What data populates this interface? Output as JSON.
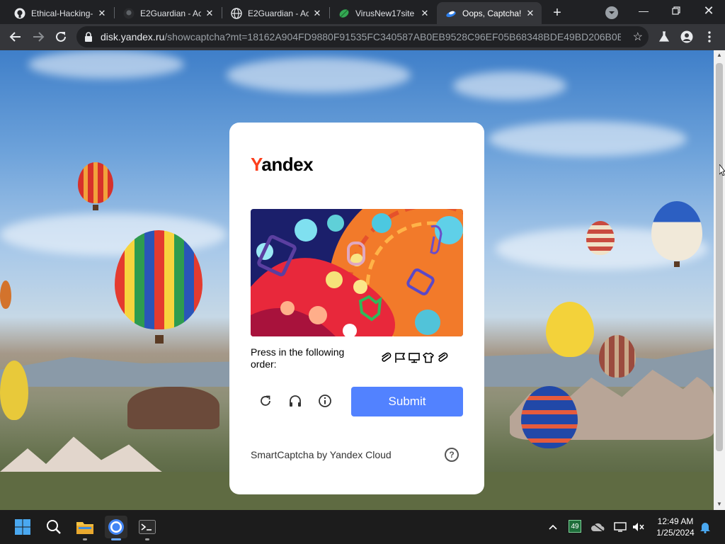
{
  "browser": {
    "tabs": [
      {
        "title": "Ethical-Hacking-",
        "favicon": "github-icon"
      },
      {
        "title": "E2Guardian - Ac",
        "favicon": "github-icon"
      },
      {
        "title": "E2Guardian - Ac",
        "favicon": "globe-icon"
      },
      {
        "title": "VirusNew17site",
        "favicon": "leaf-icon"
      },
      {
        "title": "Oops, Captcha!",
        "favicon": "yandex-disk-icon",
        "active": true
      }
    ],
    "url": {
      "host": "disk.yandex.ru",
      "path": "/showcaptcha?mt=18162A904FD9880F91535FC340587AB0EB9528C96EF05B68348BDE49BD206B0B..."
    }
  },
  "captcha": {
    "brand": {
      "first_letter": "Y",
      "rest": "andex",
      "first_letter_color": "#fc3f1d"
    },
    "prompt": "Press in the following order:",
    "order_icons": [
      "paperclip-icon",
      "flag-icon",
      "monitor-icon",
      "tshirt-icon",
      "paperclip-icon"
    ],
    "controls": [
      "refresh-icon",
      "audio-headphones-icon",
      "info-icon"
    ],
    "submit_label": "Submit",
    "submit_color": "#5282ff",
    "footer": "SmartCaptcha by Yandex Cloud"
  },
  "taskbar": {
    "apps": [
      "windows-start-icon",
      "search-icon",
      "file-explorer-icon",
      "chrome-icon",
      "terminal-icon"
    ],
    "tray": {
      "battery_badge": "49"
    },
    "clock": {
      "time": "12:49 AM",
      "date": "1/25/2024"
    }
  }
}
